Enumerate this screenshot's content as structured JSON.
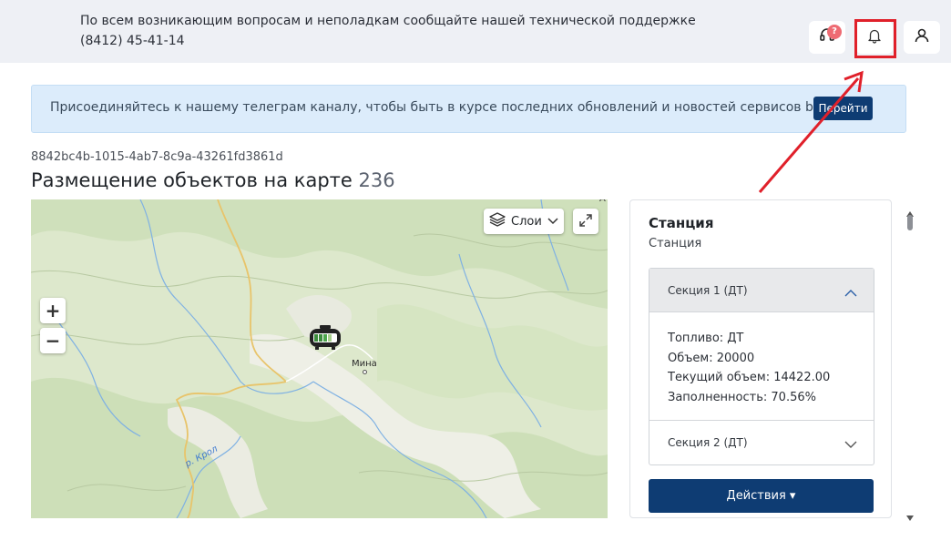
{
  "topbar": {
    "message": "По всем возникающим вопросам и неполадкам сообщайте нашей технической поддержке (8412) 45-41-14",
    "support_badge": "?",
    "support_icon": "headset-icon",
    "notifications_icon": "bell-icon",
    "profile_icon": "user-icon"
  },
  "banner": {
    "text": "Присоединяйтесь к нашему телеграм каналу, чтобы быть в курсе последних обновлений и новостей сервисов benzamat",
    "button_label": "Перейти"
  },
  "page": {
    "object_id": "8842bc4b-1015-4ab7-8c9a-43261fd3861d",
    "title": "Размещение объектов на карте",
    "count": "236"
  },
  "map": {
    "layers_label": "Слои",
    "zoom_in_label": "+",
    "zoom_out_label": "−",
    "place_label": "Мина",
    "river_label": "р. Крол",
    "corner_letter": "А"
  },
  "panel": {
    "title": "Станция",
    "subtitle": "Станция",
    "sections": [
      {
        "label": "Секция 1 (ДТ)",
        "expanded": true,
        "details": [
          "Топливо: ДТ",
          "Объем: 20000",
          "Текущий объем: 14422.00",
          "Заполненность: 70.56%"
        ]
      },
      {
        "label": "Секция 2 (ДТ)",
        "expanded": false
      }
    ],
    "actions_label": "Действия ▾"
  },
  "colors": {
    "primary": "#0e3c73",
    "annotation": "#e0202a",
    "badge": "#ee6b73",
    "banner_bg": "#dcecfb"
  }
}
